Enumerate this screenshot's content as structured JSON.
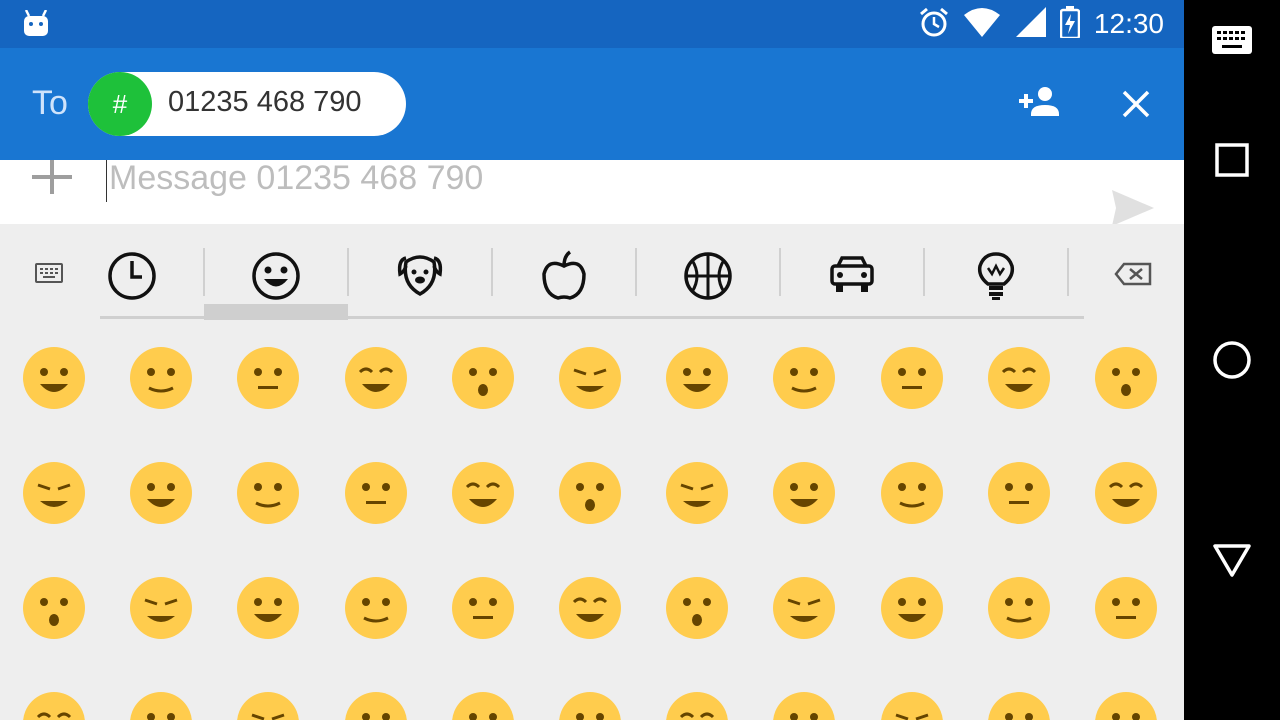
{
  "status_bar": {
    "time": "12:30",
    "icons": [
      "android-robot-icon",
      "alarm-icon",
      "wifi-icon",
      "signal-icon",
      "battery-charging-icon"
    ]
  },
  "header": {
    "to_label": "To",
    "recipient_chip": {
      "avatar_symbol": "#",
      "number": "01235 468 790",
      "avatar_color": "#1ec13a"
    },
    "actions": [
      "add-contact-icon",
      "close-icon"
    ]
  },
  "compose": {
    "placeholder": "Message 01235 468 790",
    "value": ""
  },
  "emoji_keyboard": {
    "categories": [
      "recent",
      "smileys",
      "animals",
      "food",
      "sports",
      "travel",
      "objects"
    ],
    "selected_category": "smileys",
    "visible_emoji": [
      [
        "😀",
        "😁",
        "😂",
        "🤣",
        "😃",
        "😄",
        "😅",
        "😆",
        "😉",
        "😊",
        "😋"
      ],
      [
        "😎",
        "😍",
        "😘",
        "😗",
        "😙",
        "😚",
        "🙂",
        "🙂",
        "🤗",
        "🤔",
        "😐"
      ],
      [
        "😑",
        "😶",
        "🙄",
        "😏",
        "😣",
        "😥",
        "😮",
        "🤐",
        "😯",
        "😪",
        "😫"
      ],
      [
        "😴",
        "😌",
        "🤓",
        "😛",
        "😜",
        "😝",
        "😳",
        "😒",
        "😓",
        "😔",
        "😕"
      ]
    ]
  },
  "colors": {
    "status_bar": "#1565c0",
    "app_bar": "#1976d2",
    "emoji_face": "#ffcc4d",
    "keyboard_bg": "#eeeeee"
  },
  "nav_bar": [
    "keyboard-switch-icon",
    "recents-icon",
    "home-icon",
    "back-icon"
  ]
}
